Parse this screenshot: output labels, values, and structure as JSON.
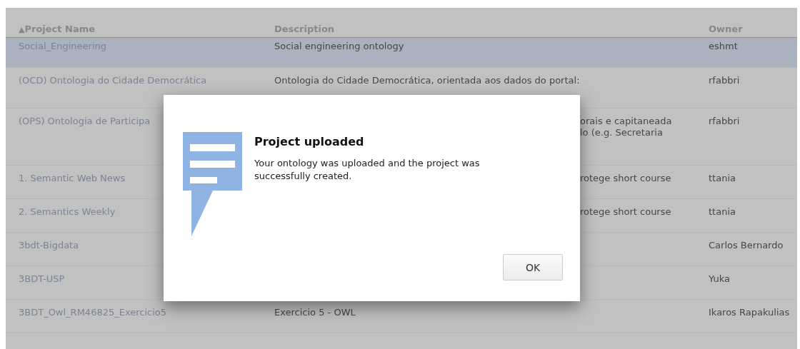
{
  "table": {
    "columns": [
      {
        "label": "Project Name",
        "sorted": true
      },
      {
        "label": "Description",
        "sorted": false
      },
      {
        "label": "Owner",
        "sorted": false
      }
    ],
    "sort_indicator": "▲",
    "rows": [
      {
        "name": "Social_Engineering",
        "description": [
          "Social engineering ontology"
        ],
        "owner": "eshmt",
        "selected": true,
        "under_dialog": false
      },
      {
        "name": "(OCD) Ontologia do Cidade Democrática",
        "description": [
          "Ontologia do Cidade Democrática, orientada aos dados do portal:"
        ],
        "owner": "rfabbri",
        "selected": false,
        "under_dialog": false
      },
      {
        "name": "(OPS) Ontologia de Participa",
        "description": [
          "orais e capitaneada",
          "lo (e.g. Secretaria"
        ],
        "owner": "rfabbri",
        "selected": false,
        "under_dialog": true
      },
      {
        "name": "1. Semantic Web News",
        "description": [
          "rotege short course"
        ],
        "owner": "ttania",
        "selected": false,
        "under_dialog": true
      },
      {
        "name": "2. Semantics Weekly",
        "description": [
          "rotege short course"
        ],
        "owner": "ttania",
        "selected": false,
        "under_dialog": true
      },
      {
        "name": "3bdt-Bigdata",
        "owner": "Carlos Bernardo",
        "selected": false,
        "under_dialog": true
      },
      {
        "name": "3BDT-USP",
        "owner": "Yuka",
        "selected": false,
        "under_dialog": true
      },
      {
        "name": "3BDT_Owl_RM46825_Exercicio5",
        "description": [
          "Exercicio 5 - OWL"
        ],
        "owner": "Ikaros Rapakulias",
        "selected": false,
        "under_dialog": false
      }
    ]
  },
  "dialog": {
    "title": "Project uploaded",
    "message": "Your ontology was uploaded and the project was successfully created.",
    "button": "OK"
  }
}
